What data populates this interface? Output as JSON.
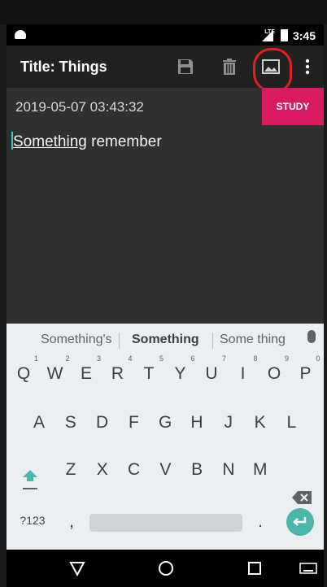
{
  "status": {
    "time": "3:45",
    "network": "LTE"
  },
  "toolbar": {
    "title": "Title: Things"
  },
  "note": {
    "date": "2019-05-07 03:43:32",
    "study_label": "STUDY",
    "text_underlined": "Something",
    "text_rest": " remember"
  },
  "keyboard": {
    "suggestions": [
      "Something's",
      "Something",
      "Some thing"
    ],
    "row1": [
      "Q",
      "W",
      "E",
      "R",
      "T",
      "Y",
      "U",
      "I",
      "O",
      "P"
    ],
    "row1_hints": [
      "1",
      "2",
      "3",
      "4",
      "5",
      "6",
      "7",
      "8",
      "9",
      "0"
    ],
    "row2": [
      "A",
      "S",
      "D",
      "F",
      "G",
      "H",
      "J",
      "K",
      "L"
    ],
    "row3": [
      "Z",
      "X",
      "C",
      "V",
      "B",
      "N",
      "M"
    ],
    "symbols_label": "?123",
    "comma": ",",
    "period": "."
  },
  "colors": {
    "accent": "#d81b60",
    "toolbar": "#212121",
    "annotation": "#e0201c",
    "enter": "#4db6ac"
  }
}
